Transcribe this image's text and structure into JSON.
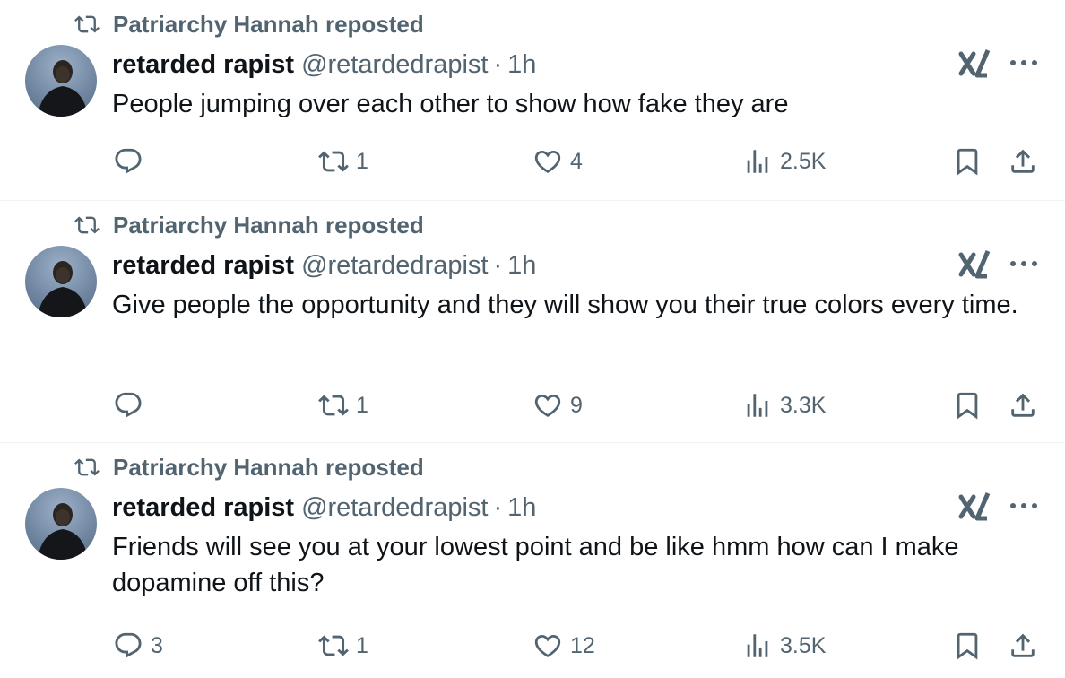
{
  "posts": [
    {
      "repost_text": "Patriarchy Hannah reposted",
      "display_name": "retarded rapist",
      "handle": "@retardedrapist",
      "separator": "·",
      "time": "1h",
      "body": "People jumping over each other to show how fake they are",
      "replies": "",
      "reposts": "1",
      "likes": "4",
      "views": "2.5K"
    },
    {
      "repost_text": "Patriarchy Hannah reposted",
      "display_name": "retarded rapist",
      "handle": "@retardedrapist",
      "separator": "·",
      "time": "1h",
      "body": "Give people the opportunity and they will show you their true colors every time.",
      "replies": "",
      "reposts": "1",
      "likes": "9",
      "views": "3.3K"
    },
    {
      "repost_text": "Patriarchy Hannah reposted",
      "display_name": "retarded rapist",
      "handle": "@retardedrapist",
      "separator": "·",
      "time": "1h",
      "body": "Friends will see you at your lowest point and be like hmm how can I make dopamine off this?",
      "replies": "3",
      "reposts": "1",
      "likes": "12",
      "views": "3.5K"
    }
  ],
  "icons": {
    "repost": "repost-icon",
    "reply": "reply-icon",
    "like": "heart-icon",
    "views": "views-icon",
    "bookmark": "bookmark-icon",
    "share": "share-icon",
    "grok": "grok-icon",
    "more": "more-icon"
  },
  "colors": {
    "text_primary": "#0f1419",
    "text_secondary": "#536471",
    "divider": "#eff3f4",
    "background": "#ffffff"
  }
}
